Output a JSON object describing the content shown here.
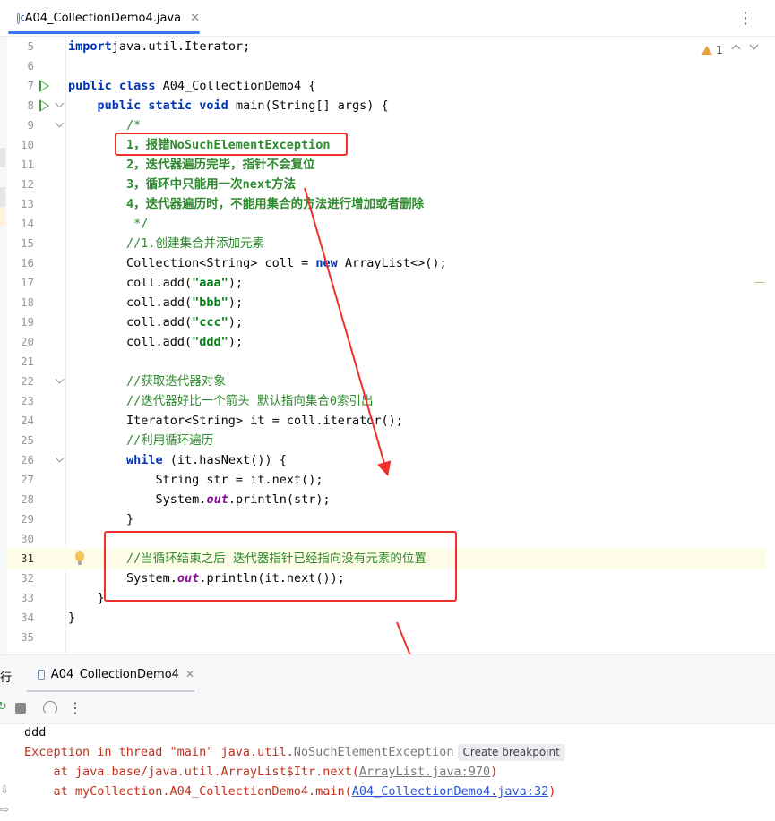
{
  "tab": {
    "title": "A04_CollectionDemo4.java",
    "close": "✕",
    "menu": "⋮"
  },
  "inspection": {
    "count": "1"
  },
  "lines": [
    {
      "n": "5",
      "segs": [
        [
          "kw",
          "import"
        ],
        [
          "",
          "java.util.Iterator;"
        ]
      ]
    },
    {
      "n": "6",
      "segs": []
    },
    {
      "n": "7",
      "segs": [
        [
          "kw",
          "public class"
        ],
        [
          "",
          " A04_CollectionDemo4 {"
        ]
      ]
    },
    {
      "n": "8",
      "segs": [
        [
          "",
          "    "
        ],
        [
          "kw",
          "public static void"
        ],
        [
          "",
          " main(String[] args) {"
        ]
      ]
    },
    {
      "n": "9",
      "segs": [
        [
          "",
          "        "
        ],
        [
          "cm",
          "/*"
        ]
      ]
    },
    {
      "n": "10",
      "segs": [
        [
          "",
          "        "
        ],
        [
          "cmb",
          "1，报错NoSuchElementException"
        ]
      ]
    },
    {
      "n": "11",
      "segs": [
        [
          "",
          "        "
        ],
        [
          "cmb",
          "2，迭代器遍历完毕，指针不会复位"
        ]
      ]
    },
    {
      "n": "12",
      "segs": [
        [
          "",
          "        "
        ],
        [
          "cmb",
          "3，循环中只能用一次next方法"
        ]
      ]
    },
    {
      "n": "13",
      "segs": [
        [
          "",
          "        "
        ],
        [
          "cmb",
          "4，迭代器遍历时，不能用集合的方法进行增加或者删除"
        ]
      ]
    },
    {
      "n": "14",
      "segs": [
        [
          "",
          "         "
        ],
        [
          "cm",
          "*/"
        ]
      ]
    },
    {
      "n": "15",
      "segs": [
        [
          "",
          "        "
        ],
        [
          "cm",
          "//1.创建集合并添加元素"
        ]
      ]
    },
    {
      "n": "16",
      "segs": [
        [
          "",
          "        Collection<String> coll = "
        ],
        [
          "kw",
          "new"
        ],
        [
          "",
          " ArrayList<>();"
        ]
      ]
    },
    {
      "n": "17",
      "segs": [
        [
          "",
          "        coll.add("
        ],
        [
          "str",
          "\"aaa\""
        ],
        [
          "",
          ");"
        ]
      ]
    },
    {
      "n": "18",
      "segs": [
        [
          "",
          "        coll.add("
        ],
        [
          "str",
          "\"bbb\""
        ],
        [
          "",
          ");"
        ]
      ]
    },
    {
      "n": "19",
      "segs": [
        [
          "",
          "        coll.add("
        ],
        [
          "str",
          "\"ccc\""
        ],
        [
          "",
          ");"
        ]
      ]
    },
    {
      "n": "20",
      "segs": [
        [
          "",
          "        coll.add("
        ],
        [
          "str",
          "\"ddd\""
        ],
        [
          "",
          ");"
        ]
      ]
    },
    {
      "n": "21",
      "segs": []
    },
    {
      "n": "22",
      "segs": [
        [
          "",
          "        "
        ],
        [
          "cm",
          "//获取迭代器对象"
        ]
      ]
    },
    {
      "n": "23",
      "segs": [
        [
          "",
          "        "
        ],
        [
          "cm",
          "//迭代器好比一个箭头 默认指向集合0索引出"
        ]
      ]
    },
    {
      "n": "24",
      "segs": [
        [
          "",
          "        Iterator<String> it = coll.iterator();"
        ]
      ]
    },
    {
      "n": "25",
      "segs": [
        [
          "",
          "        "
        ],
        [
          "cm",
          "//利用循环遍历"
        ]
      ]
    },
    {
      "n": "26",
      "segs": [
        [
          "",
          "        "
        ],
        [
          "kw",
          "while"
        ],
        [
          "",
          " (it.hasNext()) {"
        ]
      ]
    },
    {
      "n": "27",
      "segs": [
        [
          "",
          "            String str = it.next();"
        ]
      ]
    },
    {
      "n": "28",
      "segs": [
        [
          "",
          "            System."
        ],
        [
          "st",
          "out"
        ],
        [
          "",
          ".println(str);"
        ]
      ]
    },
    {
      "n": "29",
      "segs": [
        [
          "",
          "        }"
        ]
      ]
    },
    {
      "n": "30",
      "segs": []
    },
    {
      "n": "31",
      "segs": [
        [
          "",
          "        "
        ],
        [
          "cm",
          "//当循环结束之后 迭代器指针已经指向没有元素的位置"
        ]
      ]
    },
    {
      "n": "32",
      "segs": [
        [
          "",
          "        System."
        ],
        [
          "st",
          "out"
        ],
        [
          "",
          ".println(it.next());"
        ]
      ]
    },
    {
      "n": "33",
      "segs": [
        [
          "",
          "    }"
        ]
      ]
    },
    {
      "n": "34",
      "segs": [
        [
          "",
          "}"
        ]
      ]
    },
    {
      "n": "35",
      "segs": []
    }
  ],
  "run_panel": {
    "label": "行",
    "tab_title": "A04_CollectionDemo4",
    "tab_close": "✕",
    "menu": "⋮"
  },
  "console": {
    "line1": "ddd",
    "exc_prefix": "Exception in thread \"main\" java.util.",
    "exc_class": "NoSuchElementException",
    "breakpoint_chip": "Create breakpoint",
    "trace1_prefix": "    at java.base/java.util.ArrayList$Itr.next(",
    "trace1_link": "ArrayList.java:970",
    "trace1_suffix": ")",
    "trace2_prefix": "    at myCollection.A04_CollectionDemo4.main(",
    "trace2_link": "A04_CollectionDemo4.java:32",
    "trace2_suffix": ")"
  },
  "colors": {
    "annotation": "#f0302c",
    "keyword": "#0033b3",
    "comment": "#2d8a2d",
    "string": "#067d17",
    "error": "#c3321d",
    "link": "#2a55d6"
  }
}
